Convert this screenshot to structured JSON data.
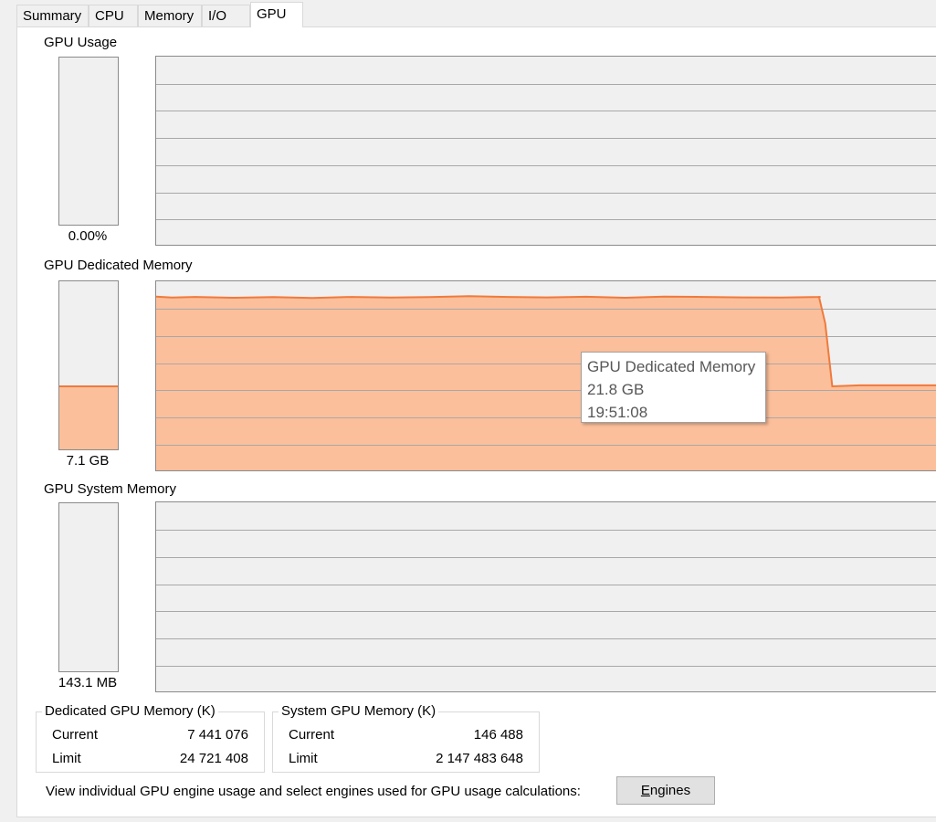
{
  "tabs": [
    {
      "label": "Summary",
      "active": false
    },
    {
      "label": "CPU",
      "active": false
    },
    {
      "label": "Memory",
      "active": false
    },
    {
      "label": "I/O",
      "active": false
    },
    {
      "label": "GPU",
      "active": true
    }
  ],
  "gpu_usage": {
    "title": "GPU Usage",
    "value": "0.00%",
    "fill_fraction": 0.0
  },
  "dedicated_memory": {
    "title": "GPU Dedicated Memory",
    "value": "7.1 GB",
    "fill_fraction": 0.38,
    "fill_color": "#fcbf9b",
    "line_color": "#f07a3c",
    "tooltip": {
      "title": "GPU Dedicated Memory",
      "value": "21.8 GB",
      "time": "19:51:08"
    }
  },
  "system_memory": {
    "title": "GPU System Memory",
    "value": "143.1 MB",
    "fill_fraction": 0.0
  },
  "chart_data": {
    "type": "area",
    "series": [
      {
        "x": [
          0,
          0.02,
          0.05,
          0.1,
          0.15,
          0.2,
          0.25,
          0.3,
          0.35,
          0.4,
          0.45,
          0.5,
          0.55,
          0.6,
          0.65,
          0.7,
          0.75,
          0.8,
          0.85,
          0.848,
          0.856,
          0.865,
          0.9,
          0.95,
          1.0
        ],
        "values": [
          0.92,
          0.915,
          0.918,
          0.914,
          0.917,
          0.913,
          0.918,
          0.915,
          0.917,
          0.922,
          0.918,
          0.916,
          0.919,
          0.914,
          0.92,
          0.918,
          0.916,
          0.915,
          0.918,
          0.918,
          0.78,
          0.45,
          0.455,
          0.455,
          0.455
        ]
      }
    ],
    "ylim": [
      0,
      1
    ],
    "grid": true
  },
  "dedicated_group": {
    "title": "Dedicated GPU Memory (K)",
    "current_label": "Current",
    "current_value": "7 441 076",
    "limit_label": "Limit",
    "limit_value": "24 721 408"
  },
  "system_group": {
    "title": "System GPU Memory (K)",
    "current_label": "Current",
    "current_value": "146 488",
    "limit_label": "Limit",
    "limit_value": "2 147 483 648"
  },
  "footer": {
    "text": "View individual GPU engine usage and select engines used for GPU usage calculations:",
    "engines_button_accel": "E",
    "engines_button_rest": "ngines"
  }
}
